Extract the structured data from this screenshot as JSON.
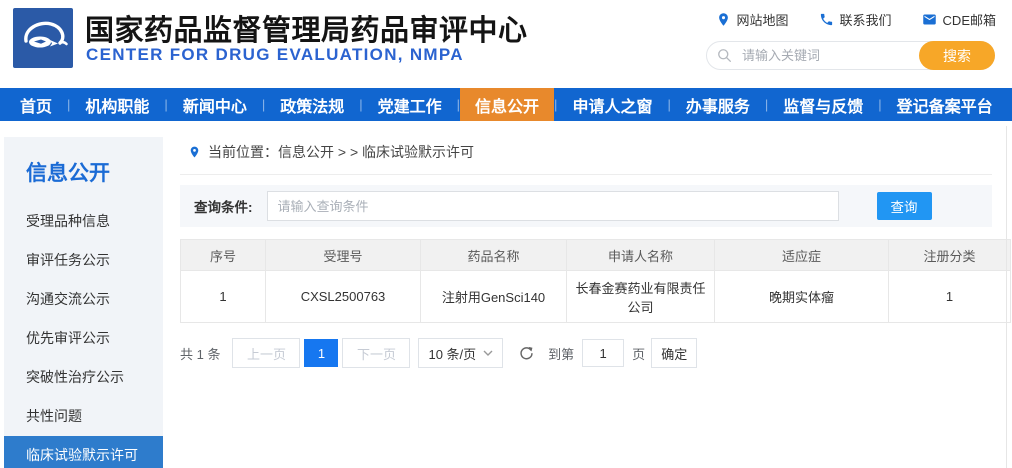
{
  "header": {
    "title": "国家药品监督管理局药品审评中心",
    "subtitle": "CENTER FOR DRUG EVALUATION, NMPA",
    "quick_links": [
      {
        "icon": "location-pin-icon",
        "label": "网站地图"
      },
      {
        "icon": "phone-icon",
        "label": "联系我们"
      },
      {
        "icon": "envelope-icon",
        "label": "CDE邮箱"
      }
    ],
    "search": {
      "placeholder": "请输入关键词",
      "button_label": "搜索"
    }
  },
  "nav": {
    "items": [
      {
        "label": "首页",
        "active": false
      },
      {
        "label": "机构职能",
        "active": false
      },
      {
        "label": "新闻中心",
        "active": false
      },
      {
        "label": "政策法规",
        "active": false
      },
      {
        "label": "党建工作",
        "active": false
      },
      {
        "label": "信息公开",
        "active": true
      },
      {
        "label": "申请人之窗",
        "active": false
      },
      {
        "label": "办事服务",
        "active": false
      },
      {
        "label": "监督与反馈",
        "active": false
      },
      {
        "label": "登记备案平台",
        "active": false
      }
    ]
  },
  "sidebar": {
    "title": "信息公开",
    "items": [
      {
        "label": "受理品种信息",
        "active": false
      },
      {
        "label": "审评任务公示",
        "active": false
      },
      {
        "label": "沟通交流公示",
        "active": false
      },
      {
        "label": "优先审评公示",
        "active": false
      },
      {
        "label": "突破性治疗公示",
        "active": false
      },
      {
        "label": "共性问题",
        "active": false
      },
      {
        "label": "临床试验默示许可",
        "active": true
      }
    ]
  },
  "breadcrumb": {
    "label": "当前位置：信息公开 > > 临床试验默示许可"
  },
  "query": {
    "label": "查询条件:",
    "placeholder": "请输入查询条件",
    "button_label": "查询"
  },
  "table": {
    "columns": [
      "序号",
      "受理号",
      "药品名称",
      "申请人名称",
      "适应症",
      "注册分类"
    ],
    "rows": [
      [
        "1",
        "CXSL2500763",
        "注射用GenSci140",
        "长春金赛药业有限责任公司",
        "晚期实体瘤",
        "1"
      ]
    ]
  },
  "pagination": {
    "total_label": "共 1 条",
    "prev_label": "上一页",
    "current_page": "1",
    "next_label": "下一页",
    "page_size_label": "10 条/页",
    "goto_label": "到第",
    "goto_value": "1",
    "page_unit_label": "页",
    "confirm_label": "确定"
  },
  "colors": {
    "nav_blue": "#1166d0",
    "nav_orange": "#e8892c",
    "subtitle_blue": "#2b63d0",
    "link_blue": "#1a6fd4",
    "search_orange": "#f7a728",
    "query_blue": "#2196f3",
    "sidebar_bg": "#f1f4f8",
    "sidebar_title_blue": "#1b6bd5",
    "sidebar_active": "#2e7ccc",
    "page_blue": "#1677f0"
  }
}
